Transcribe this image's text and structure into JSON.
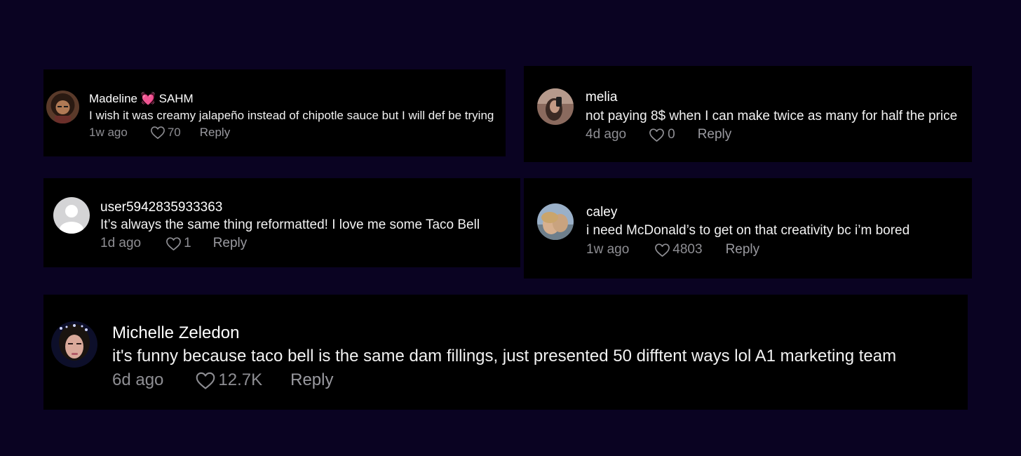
{
  "colors": {
    "page_background": "#0a0322",
    "card_background": "#000000",
    "name_text": "#ffffff",
    "body_text": "#f2f2f2",
    "meta_text": "#8e8e93"
  },
  "comments": [
    {
      "username": "Madeline 💓 SAHM",
      "text": "I wish it was creamy jalapeño instead of chipotle sauce but I will def be trying",
      "time_ago": "1w ago",
      "likes": "70",
      "reply_label": "Reply",
      "avatar": "profile-photo"
    },
    {
      "username": "melia",
      "text": "not paying 8$ when I can make twice as many for half the price",
      "time_ago": "4d ago",
      "likes": "0",
      "reply_label": "Reply",
      "avatar": "profile-photo"
    },
    {
      "username": "user5942835933363",
      "text": "It’s always the same thing reformatted! I love me some Taco Bell",
      "time_ago": "1d ago",
      "likes": "1",
      "reply_label": "Reply",
      "avatar": "default-avatar"
    },
    {
      "username": "caley",
      "text": "i need McDonald’s to get on that creativity bc i’m bored",
      "time_ago": "1w ago",
      "likes": "4803",
      "reply_label": "Reply",
      "avatar": "profile-photo"
    },
    {
      "username": "Michelle Zeledon",
      "text": "it's funny because taco bell is the same dam fillings, just presented 50 difftent ways lol A1 marketing team",
      "time_ago": "6d ago",
      "likes": "12.7K",
      "reply_label": "Reply",
      "avatar": "profile-photo"
    }
  ],
  "icons": {
    "like": "heart-outline-icon"
  }
}
